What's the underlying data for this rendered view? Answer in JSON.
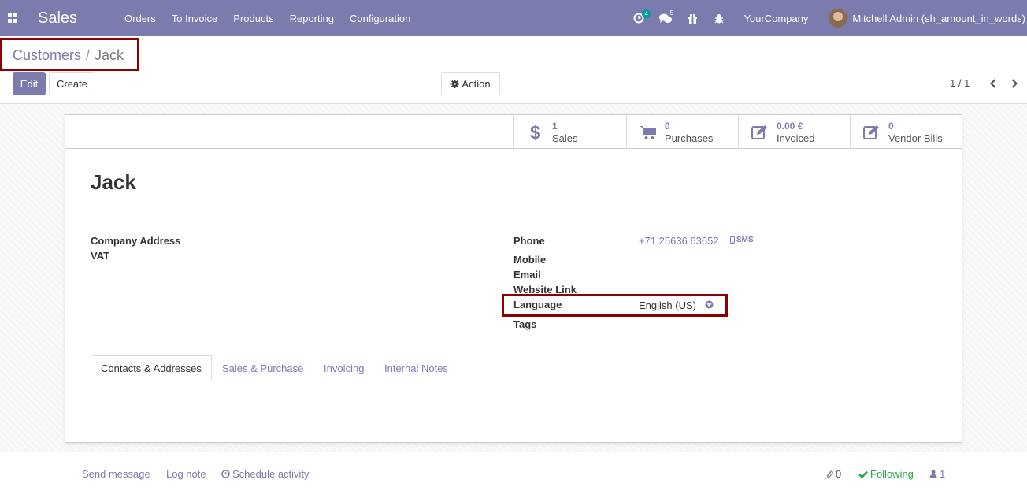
{
  "navbar": {
    "app_name": "Sales",
    "menu": [
      "Orders",
      "To Invoice",
      "Products",
      "Reporting",
      "Configuration"
    ],
    "activity_count": "4",
    "message_count": "5",
    "company": "YourCompany",
    "user": "Mitchell Admin (sh_amount_in_words)",
    "bg_color": "#7c7bad"
  },
  "control_panel": {
    "breadcrumb_parent": "Customers",
    "breadcrumb_separator": "/",
    "breadcrumb_current": "Jack",
    "edit_label": "Edit",
    "create_label": "Create",
    "action_label": "Action",
    "pager": "1 / 1"
  },
  "smart_buttons": [
    {
      "value": "1",
      "label": "Sales",
      "icon": "dollar-icon"
    },
    {
      "value": "0",
      "label": "Purchases",
      "icon": "cart-icon"
    },
    {
      "value": "0.00 €",
      "label": "Invoiced",
      "icon": "pencil-square-icon"
    },
    {
      "value": "0",
      "label": "Vendor Bills",
      "icon": "pencil-square-icon"
    }
  ],
  "partner": {
    "name": "Jack",
    "left_fields": {
      "company_address": "Company Address",
      "vat": "VAT"
    },
    "right_fields": {
      "phone": "Phone",
      "mobile": "Mobile",
      "email": "Email",
      "website": "Website Link",
      "language": "Language",
      "tags": "Tags"
    },
    "phone_value": "+71 25636 63652",
    "sms_label": "SMS",
    "language_value": "English (US)"
  },
  "tabs": [
    "Contacts & Addresses",
    "Sales & Purchase",
    "Invoicing",
    "Internal Notes"
  ],
  "chatter": {
    "send_message": "Send message",
    "log_note": "Log note",
    "schedule_activity": "Schedule activity",
    "attachments": "0",
    "following": "Following",
    "followers": "1"
  },
  "highlight_color": "#8b0000"
}
